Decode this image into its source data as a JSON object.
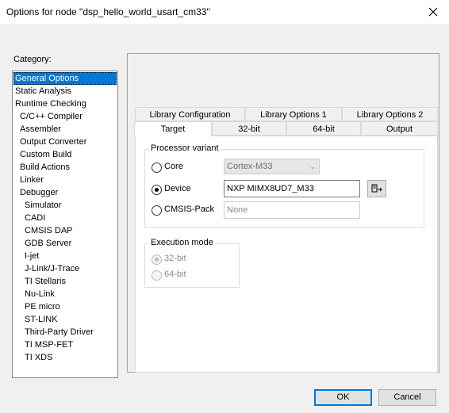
{
  "window": {
    "title": "Options for node \"dsp_hello_world_usart_cm33\"",
    "close_icon": "close-icon"
  },
  "category": {
    "label": "Category:",
    "items": [
      "General Options",
      "Static Analysis",
      "Runtime Checking",
      "C/C++ Compiler",
      "Assembler",
      "Output Converter",
      "Custom Build",
      "Build Actions",
      "Linker",
      "Debugger",
      "Simulator",
      "CADI",
      "CMSIS DAP",
      "GDB Server",
      "I-jet",
      "J-Link/J-Trace",
      "TI Stellaris",
      "Nu-Link",
      "PE micro",
      "ST-LINK",
      "Third-Party Driver",
      "TI MSP-FET",
      "TI XDS"
    ],
    "selected": "General Options"
  },
  "tabs": {
    "row1": [
      "Library Configuration",
      "Library Options 1",
      "Library Options 2"
    ],
    "row2": [
      "Target",
      "32-bit",
      "64-bit",
      "Output"
    ],
    "active": "Target"
  },
  "processor_variant": {
    "title": "Processor variant",
    "core_label": "Core",
    "core_value": "Cortex-M33",
    "device_label": "Device",
    "device_value": "NXP MIMX8UD7_M33",
    "cmsis_label": "CMSIS-Pack",
    "cmsis_value": "None",
    "selected": "Device",
    "device_select_icon": "select-device-icon"
  },
  "execution_mode": {
    "title": "Execution mode",
    "opt_32": "32-bit",
    "opt_64": "64-bit",
    "selected": "32-bit"
  },
  "buttons": {
    "ok": "OK",
    "cancel": "Cancel"
  }
}
